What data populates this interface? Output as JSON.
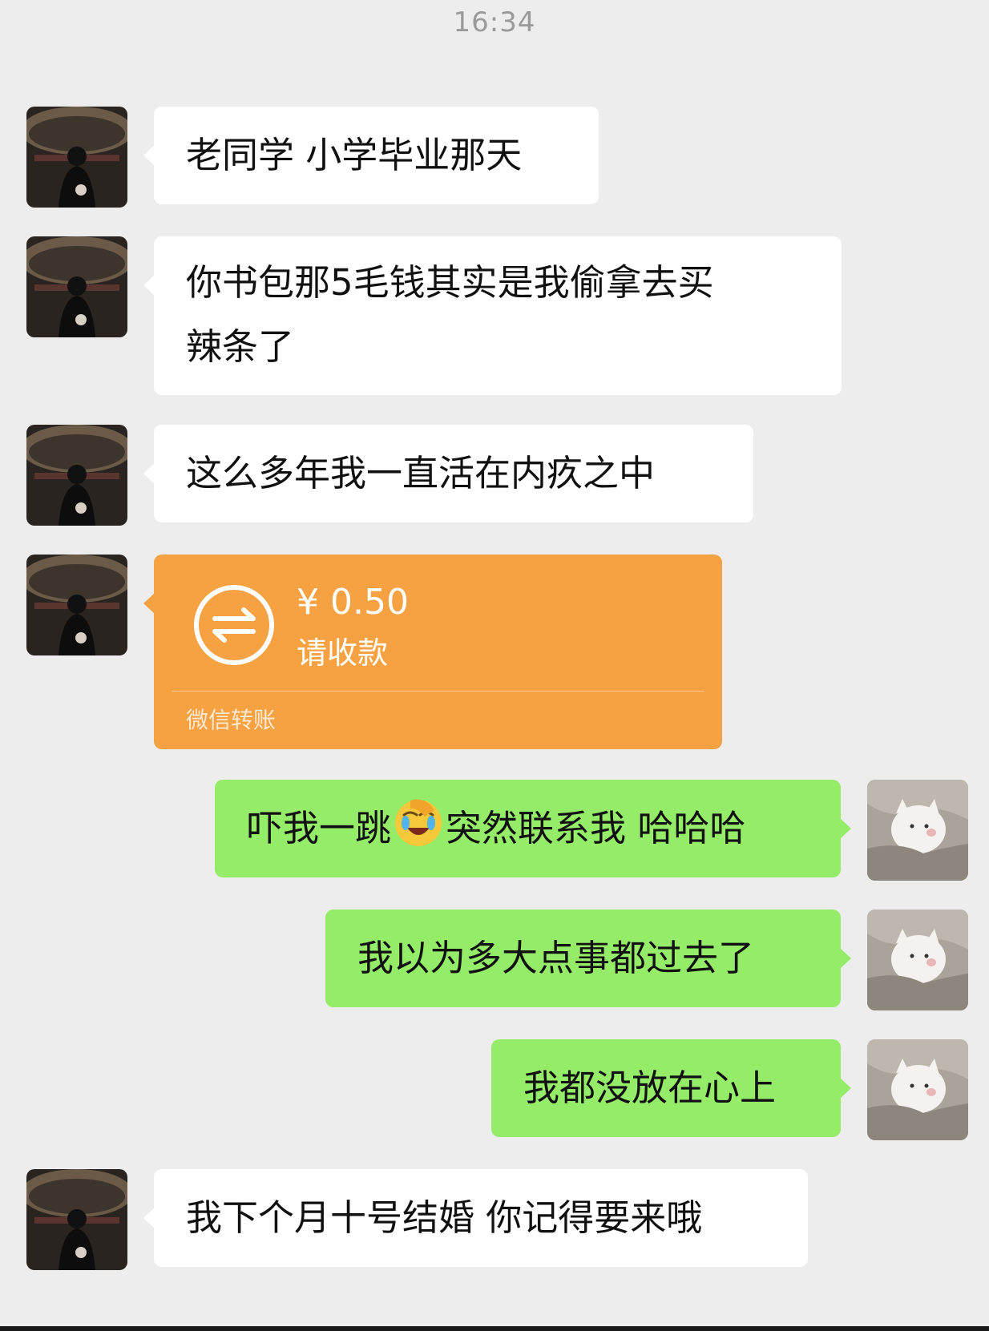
{
  "status": {
    "time": "16:34"
  },
  "colors": {
    "background": "#ededed",
    "incoming_bubble": "#ffffff",
    "outgoing_bubble": "#95ec69",
    "transfer_card": "#f6a243"
  },
  "contact": {
    "avatar_icon": "person-with-umbrella-photo"
  },
  "me": {
    "avatar_icon": "white-kitten-photo"
  },
  "messages": [
    {
      "from": "contact",
      "type": "text",
      "text": "老同学 小学毕业那天"
    },
    {
      "from": "contact",
      "type": "text",
      "lines": [
        "你书包那5毛钱其实是我偷拿去买",
        "辣条了"
      ]
    },
    {
      "from": "contact",
      "type": "text",
      "text": "这么多年我一直活在内疚之中"
    },
    {
      "from": "contact",
      "type": "transfer",
      "amount": "¥ 0.50",
      "status": "请收款",
      "footer": "微信转账",
      "icon": "transfer-arrows-icon"
    },
    {
      "from": "me",
      "type": "text",
      "text_before": "吓我一跳",
      "emoji": "facepalm-crying-emoji",
      "text_after": "突然联系我 哈哈哈"
    },
    {
      "from": "me",
      "type": "text",
      "text": "我以为多大点事都过去了"
    },
    {
      "from": "me",
      "type": "text",
      "text": "我都没放在心上"
    },
    {
      "from": "contact",
      "type": "text",
      "text": "我下个月十号结婚 你记得要来哦"
    }
  ]
}
